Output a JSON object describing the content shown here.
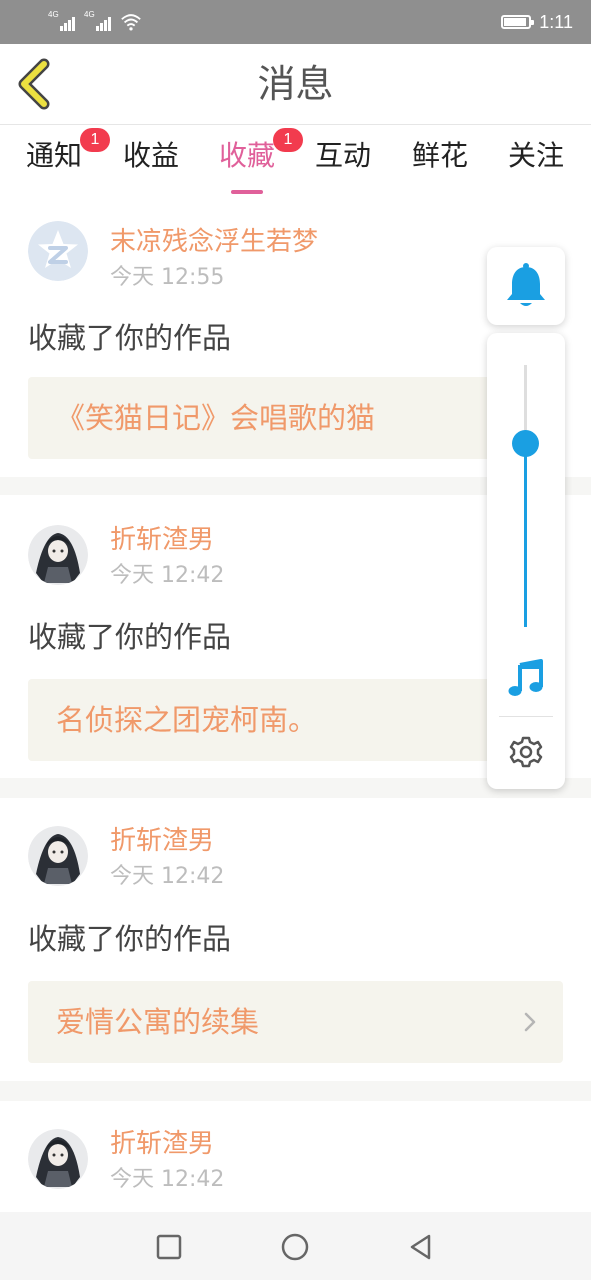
{
  "status_bar": {
    "signal_1": "4G",
    "signal_2": "4G",
    "time": "1:11",
    "battery_level": 0.9
  },
  "header": {
    "title": "消息"
  },
  "tabs": [
    {
      "label": "通知",
      "badge": "1",
      "active": false
    },
    {
      "label": "收益",
      "badge": "",
      "active": false
    },
    {
      "label": "收藏",
      "badge": "1",
      "active": true
    },
    {
      "label": "互动",
      "badge": "",
      "active": false
    },
    {
      "label": "鲜花",
      "badge": "",
      "active": false
    },
    {
      "label": "关注",
      "badge": "",
      "active": false
    }
  ],
  "messages": [
    {
      "user": "末凉残念浮生若梦",
      "time": "今天 12:55",
      "action": "收藏了你的作品",
      "work": "《笑猫日记》会唱歌的猫",
      "avatar": "default-avatar"
    },
    {
      "user": "折斩渣男",
      "time": "今天 12:42",
      "action": "收藏了你的作品",
      "work": "名侦探之团宠柯南。",
      "avatar": "anime-avatar"
    },
    {
      "user": "折斩渣男",
      "time": "今天 12:42",
      "action": "收藏了你的作品",
      "work": "爱情公寓的续集",
      "avatar": "anime-avatar"
    },
    {
      "user": "折斩渣男",
      "time": "今天 12:42",
      "action": "",
      "work": "",
      "avatar": "anime-avatar"
    }
  ],
  "floating_panel": {
    "top_icon": "bell-icon",
    "volume_level": 0.7,
    "music_icon": "music-note-icon",
    "settings_icon": "gear-icon"
  },
  "colors": {
    "accent_pink": "#e0609a",
    "username_orange": "#f0996a",
    "badge_red": "#f23b4e",
    "slider_blue": "#1a9fe2",
    "back_arrow_yellow": "#ece040"
  }
}
